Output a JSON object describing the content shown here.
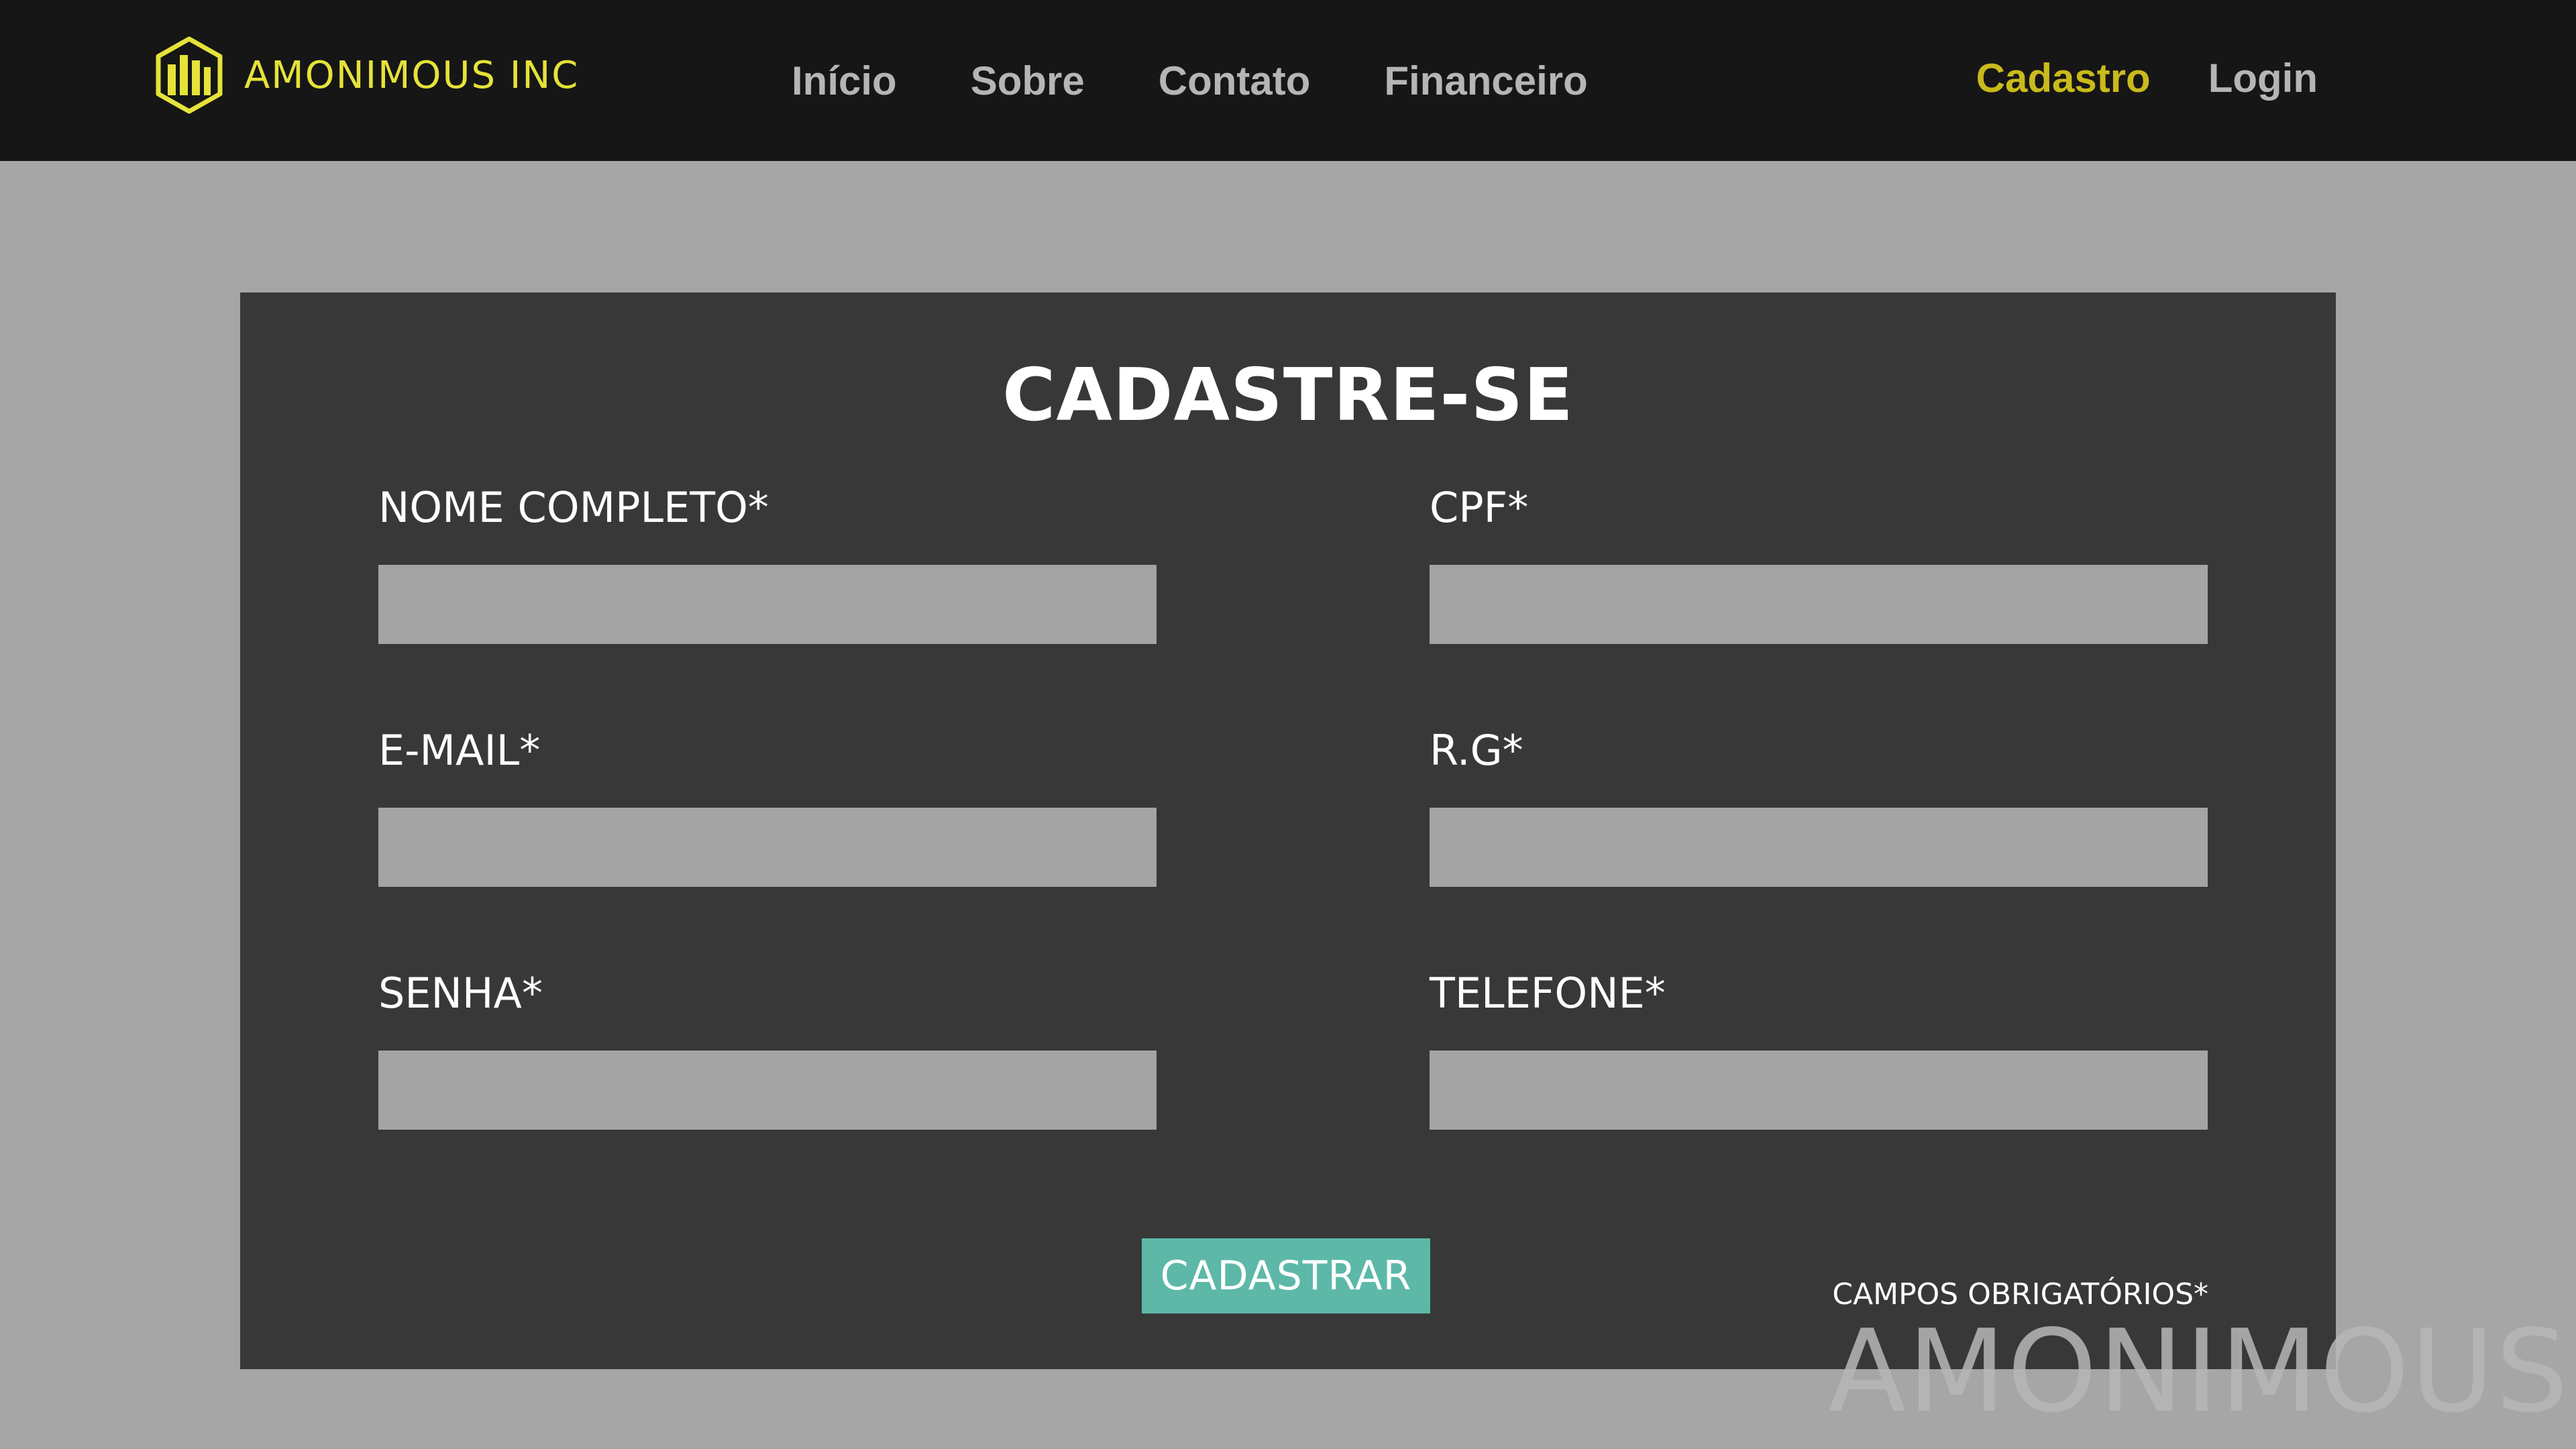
{
  "header": {
    "brand": {
      "name": "AMONIMOUS INC",
      "logo_icon": "building-columns-hexagon-icon",
      "color": "#e5e23a"
    },
    "nav": [
      {
        "label": "Início"
      },
      {
        "label": "Sobre"
      },
      {
        "label": "Contato"
      },
      {
        "label": "Financeiro"
      }
    ],
    "auth": {
      "cadastro_label": "Cadastro",
      "login_label": "Login",
      "active_color": "#c9ba1c"
    }
  },
  "form": {
    "title": "CADASTRE-SE",
    "fields": {
      "nome": {
        "label": "NOME COMPLETO*",
        "value": ""
      },
      "cpf": {
        "label": "CPF*",
        "value": ""
      },
      "email": {
        "label": "E-MAIL*",
        "value": ""
      },
      "rg": {
        "label": "R.G*",
        "value": ""
      },
      "senha": {
        "label": "SENHA*",
        "value": ""
      },
      "telefone": {
        "label": "TELEFONE*",
        "value": ""
      }
    },
    "submit_label": "CADASTRAR",
    "required_note": "CAMPOS OBRIGATÓRIOS*",
    "submit_color": "#5db8a8"
  },
  "watermark": "AMONIMOUS",
  "colors": {
    "background": "#a6a6a6",
    "header": "#161616",
    "card": "#383838",
    "input": "#a4a4a4"
  }
}
